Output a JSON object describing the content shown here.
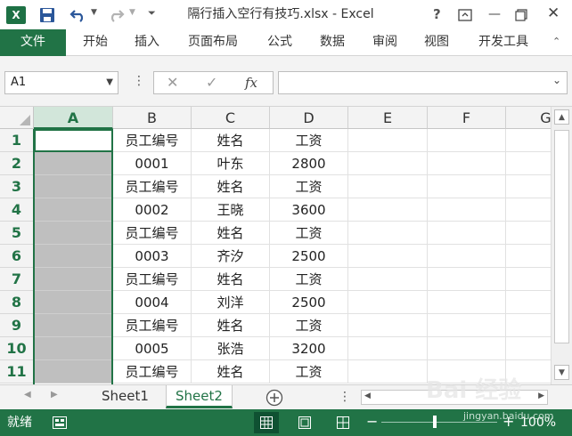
{
  "app": {
    "title": "隔行插入空行有技巧.xlsx - Excel",
    "logo": "X",
    "help": "?",
    "accent": "#217346"
  },
  "ribbon": {
    "tabs": [
      "文件",
      "开始",
      "插入",
      "页面布局",
      "公式",
      "数据",
      "审阅",
      "视图",
      "开发工具"
    ]
  },
  "formula_bar": {
    "name_box": "A1",
    "fx_label": "fx",
    "formula": ""
  },
  "grid": {
    "columns": [
      "A",
      "B",
      "C",
      "D",
      "E",
      "F",
      "G"
    ],
    "rows": [
      {
        "n": "1",
        "b": "员工编号",
        "c": "姓名",
        "d": "工资"
      },
      {
        "n": "2",
        "b": "0001",
        "c": "叶东",
        "d": "2800"
      },
      {
        "n": "3",
        "b": "员工编号",
        "c": "姓名",
        "d": "工资"
      },
      {
        "n": "4",
        "b": "0002",
        "c": "王晓",
        "d": "3600"
      },
      {
        "n": "5",
        "b": "员工编号",
        "c": "姓名",
        "d": "工资"
      },
      {
        "n": "6",
        "b": "0003",
        "c": "齐汐",
        "d": "2500"
      },
      {
        "n": "7",
        "b": "员工编号",
        "c": "姓名",
        "d": "工资"
      },
      {
        "n": "8",
        "b": "0004",
        "c": "刘洋",
        "d": "2500"
      },
      {
        "n": "9",
        "b": "员工编号",
        "c": "姓名",
        "d": "工资"
      },
      {
        "n": "10",
        "b": "0005",
        "c": "张浩",
        "d": "3200"
      },
      {
        "n": "11",
        "b": "员工编号",
        "c": "姓名",
        "d": "工资"
      }
    ]
  },
  "sheets": [
    "Sheet1",
    "Sheet2"
  ],
  "status": {
    "ready": "就绪",
    "zoom": "100%"
  },
  "watermark": {
    "main": "Bai 经验",
    "sub": "jingyan.baidu.com"
  }
}
